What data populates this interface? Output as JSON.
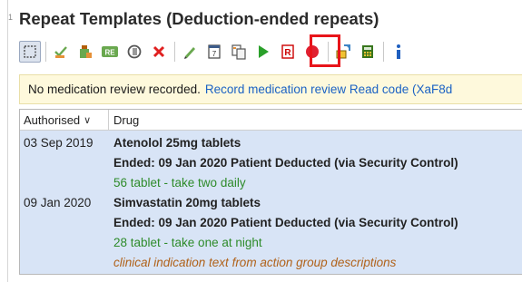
{
  "panel": {
    "gutter_mark": "1",
    "title": "Repeat Templates (Deduction-ended repeats)"
  },
  "toolbar": {
    "highlighted_button": "play-button",
    "highlight_color": "#e8141a",
    "buttons": [
      "select-icon",
      "prescribe-icon",
      "bottle-icon",
      "rx-icon",
      "review-icon",
      "cancel-icon",
      "edit-icon",
      "document-icon",
      "copy-icon",
      "play-icon",
      "record-icon",
      "stop-icon",
      "reorder-icon",
      "calculator-icon",
      "info-icon"
    ]
  },
  "banner": {
    "text": "No medication review recorded.",
    "link": "Record medication review Read code (XaF8d"
  },
  "table": {
    "columns": {
      "authorised": "Authorised",
      "drug": "Drug"
    },
    "rows": [
      {
        "date": "03 Sep 2019",
        "drug": "Atenolol 25mg tablets",
        "ended": "Ended: 09 Jan 2020 Patient Deducted (via Security Control)",
        "dosage": "56 tablet - take two daily"
      },
      {
        "date": "09 Jan 2020",
        "drug": "Simvastatin 20mg tablets",
        "ended": "Ended: 09 Jan 2020 Patient Deducted (via Security Control)",
        "dosage": "28 tablet - take one at night",
        "indication": "clinical indication text from action group descriptions"
      }
    ]
  },
  "colors": {
    "row_background": "#d8e4f6",
    "dosage_text": "#2e8b2a",
    "indication_text": "#b0621a",
    "link_text": "#1b62c4",
    "banner_background": "#fef9dc"
  }
}
